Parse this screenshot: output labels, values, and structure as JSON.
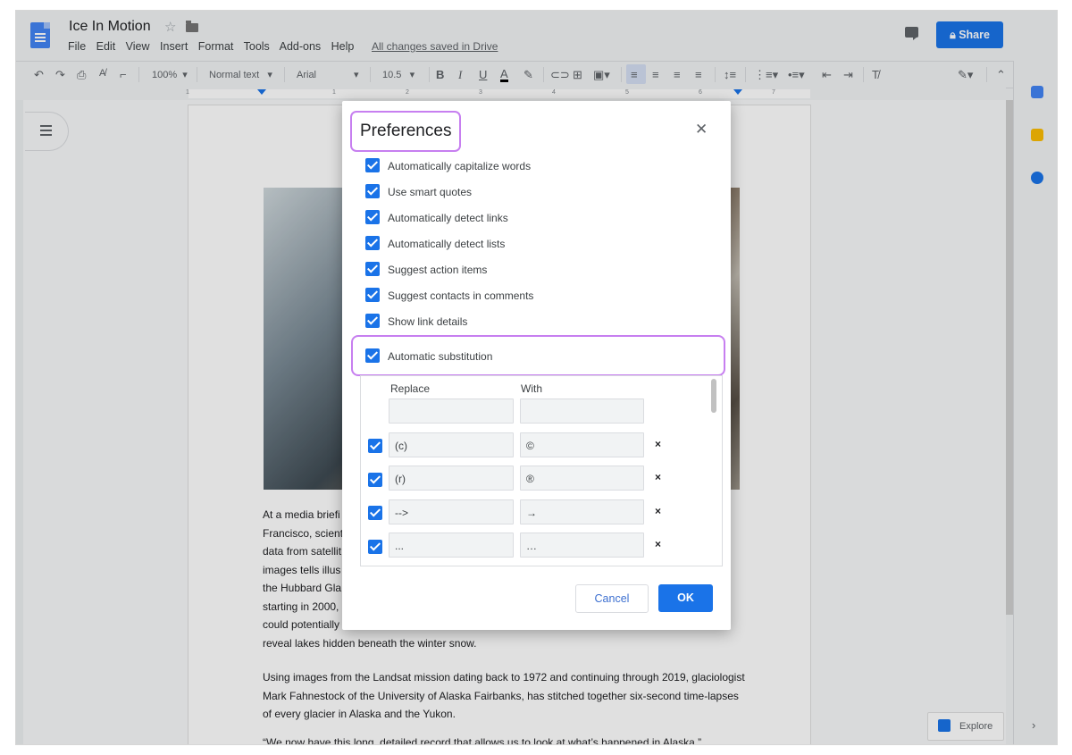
{
  "doc": {
    "title": "Ice In Motion",
    "menu": [
      "File",
      "Edit",
      "View",
      "Insert",
      "Format",
      "Tools",
      "Add-ons",
      "Help"
    ],
    "save_status": "All changes saved in Drive",
    "share_label": "Share"
  },
  "toolbar": {
    "zoom": "100%",
    "style": "Normal text",
    "font": "Arial",
    "size": "10.5",
    "bold": "B",
    "italic": "I",
    "underline": "U",
    "text_color": "A"
  },
  "ruler": {
    "ticks": [
      "1",
      "1",
      "2",
      "3",
      "4",
      "5",
      "6",
      "7"
    ]
  },
  "body": {
    "para1": [
      "At a media briefi",
      "Francisco, scient",
      "data from satellit",
      "images tells illus",
      "the Hubbard Gla",
      "starting in 2000,",
      "could potentially",
      "reveal lakes hidden beneath the winter snow."
    ],
    "para2": "Using images from the Landsat mission dating back to 1972 and continuing through 2019, glaciologist Mark Fahnestock of the University of Alaska Fairbanks, has stitched together six-second time-lapses of every glacier in Alaska and the Yukon.",
    "para3": "“We now have this long, detailed record that allows us to look at what’s happened in Alaska,”"
  },
  "explore_label": "Explore",
  "dialog": {
    "title": "Preferences",
    "options": [
      {
        "label": "Automatically capitalize words",
        "checked": true
      },
      {
        "label": "Use smart quotes",
        "checked": true
      },
      {
        "label": "Automatically detect links",
        "checked": true
      },
      {
        "label": "Automatically detect lists",
        "checked": true
      },
      {
        "label": "Suggest action items",
        "checked": true
      },
      {
        "label": "Suggest contacts in comments",
        "checked": true
      },
      {
        "label": "Show link details",
        "checked": true
      }
    ],
    "substitution": {
      "label": "Automatic substitution",
      "checked": true
    },
    "table": {
      "replace_header": "Replace",
      "with_header": "With",
      "rows": [
        {
          "replace": "(c)",
          "with": "©"
        },
        {
          "replace": "(r)",
          "with": "®"
        },
        {
          "replace": "-->",
          "with": "→"
        },
        {
          "replace": "...",
          "with": "…"
        }
      ],
      "remove_glyph": "×"
    },
    "cancel_label": "Cancel",
    "ok_label": "OK"
  },
  "colors": {
    "accent": "#1a73e8",
    "highlight": "#c77ff0"
  }
}
